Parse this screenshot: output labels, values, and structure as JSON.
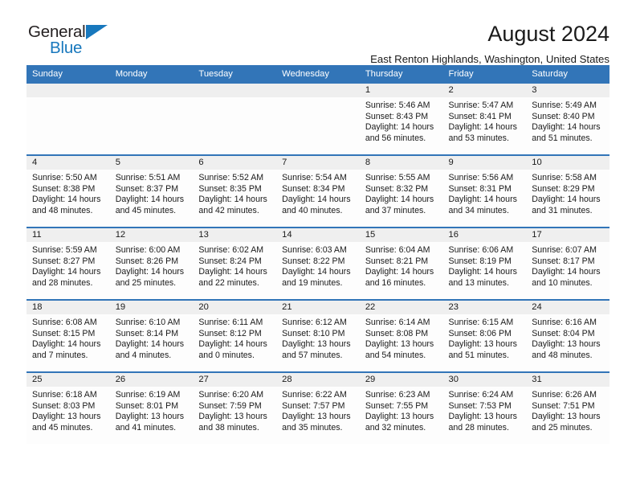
{
  "brand": {
    "name_part1": "General",
    "name_part2": "Blue",
    "triangle_icon": "triangle-icon",
    "accent_color": "#1878bd"
  },
  "header": {
    "title": "August 2024",
    "subtitle": "East Renton Highlands, Washington, United States",
    "header_bg_color": "#3275b8",
    "daynum_strip_color": "#efefef"
  },
  "weekday_headers": [
    "Sunday",
    "Monday",
    "Tuesday",
    "Wednesday",
    "Thursday",
    "Friday",
    "Saturday"
  ],
  "labels": {
    "sunrise_prefix": "Sunrise:",
    "sunset_prefix": "Sunset:",
    "daylight_prefix": "Daylight:"
  },
  "weeks": [
    [
      {
        "day": "",
        "sunrise": "",
        "sunset": "",
        "daylight": ""
      },
      {
        "day": "",
        "sunrise": "",
        "sunset": "",
        "daylight": ""
      },
      {
        "day": "",
        "sunrise": "",
        "sunset": "",
        "daylight": ""
      },
      {
        "day": "",
        "sunrise": "",
        "sunset": "",
        "daylight": ""
      },
      {
        "day": "1",
        "sunrise": "Sunrise: 5:46 AM",
        "sunset": "Sunset: 8:43 PM",
        "daylight": "Daylight: 14 hours and 56 minutes."
      },
      {
        "day": "2",
        "sunrise": "Sunrise: 5:47 AM",
        "sunset": "Sunset: 8:41 PM",
        "daylight": "Daylight: 14 hours and 53 minutes."
      },
      {
        "day": "3",
        "sunrise": "Sunrise: 5:49 AM",
        "sunset": "Sunset: 8:40 PM",
        "daylight": "Daylight: 14 hours and 51 minutes."
      }
    ],
    [
      {
        "day": "4",
        "sunrise": "Sunrise: 5:50 AM",
        "sunset": "Sunset: 8:38 PM",
        "daylight": "Daylight: 14 hours and 48 minutes."
      },
      {
        "day": "5",
        "sunrise": "Sunrise: 5:51 AM",
        "sunset": "Sunset: 8:37 PM",
        "daylight": "Daylight: 14 hours and 45 minutes."
      },
      {
        "day": "6",
        "sunrise": "Sunrise: 5:52 AM",
        "sunset": "Sunset: 8:35 PM",
        "daylight": "Daylight: 14 hours and 42 minutes."
      },
      {
        "day": "7",
        "sunrise": "Sunrise: 5:54 AM",
        "sunset": "Sunset: 8:34 PM",
        "daylight": "Daylight: 14 hours and 40 minutes."
      },
      {
        "day": "8",
        "sunrise": "Sunrise: 5:55 AM",
        "sunset": "Sunset: 8:32 PM",
        "daylight": "Daylight: 14 hours and 37 minutes."
      },
      {
        "day": "9",
        "sunrise": "Sunrise: 5:56 AM",
        "sunset": "Sunset: 8:31 PM",
        "daylight": "Daylight: 14 hours and 34 minutes."
      },
      {
        "day": "10",
        "sunrise": "Sunrise: 5:58 AM",
        "sunset": "Sunset: 8:29 PM",
        "daylight": "Daylight: 14 hours and 31 minutes."
      }
    ],
    [
      {
        "day": "11",
        "sunrise": "Sunrise: 5:59 AM",
        "sunset": "Sunset: 8:27 PM",
        "daylight": "Daylight: 14 hours and 28 minutes."
      },
      {
        "day": "12",
        "sunrise": "Sunrise: 6:00 AM",
        "sunset": "Sunset: 8:26 PM",
        "daylight": "Daylight: 14 hours and 25 minutes."
      },
      {
        "day": "13",
        "sunrise": "Sunrise: 6:02 AM",
        "sunset": "Sunset: 8:24 PM",
        "daylight": "Daylight: 14 hours and 22 minutes."
      },
      {
        "day": "14",
        "sunrise": "Sunrise: 6:03 AM",
        "sunset": "Sunset: 8:22 PM",
        "daylight": "Daylight: 14 hours and 19 minutes."
      },
      {
        "day": "15",
        "sunrise": "Sunrise: 6:04 AM",
        "sunset": "Sunset: 8:21 PM",
        "daylight": "Daylight: 14 hours and 16 minutes."
      },
      {
        "day": "16",
        "sunrise": "Sunrise: 6:06 AM",
        "sunset": "Sunset: 8:19 PM",
        "daylight": "Daylight: 14 hours and 13 minutes."
      },
      {
        "day": "17",
        "sunrise": "Sunrise: 6:07 AM",
        "sunset": "Sunset: 8:17 PM",
        "daylight": "Daylight: 14 hours and 10 minutes."
      }
    ],
    [
      {
        "day": "18",
        "sunrise": "Sunrise: 6:08 AM",
        "sunset": "Sunset: 8:15 PM",
        "daylight": "Daylight: 14 hours and 7 minutes."
      },
      {
        "day": "19",
        "sunrise": "Sunrise: 6:10 AM",
        "sunset": "Sunset: 8:14 PM",
        "daylight": "Daylight: 14 hours and 4 minutes."
      },
      {
        "day": "20",
        "sunrise": "Sunrise: 6:11 AM",
        "sunset": "Sunset: 8:12 PM",
        "daylight": "Daylight: 14 hours and 0 minutes."
      },
      {
        "day": "21",
        "sunrise": "Sunrise: 6:12 AM",
        "sunset": "Sunset: 8:10 PM",
        "daylight": "Daylight: 13 hours and 57 minutes."
      },
      {
        "day": "22",
        "sunrise": "Sunrise: 6:14 AM",
        "sunset": "Sunset: 8:08 PM",
        "daylight": "Daylight: 13 hours and 54 minutes."
      },
      {
        "day": "23",
        "sunrise": "Sunrise: 6:15 AM",
        "sunset": "Sunset: 8:06 PM",
        "daylight": "Daylight: 13 hours and 51 minutes."
      },
      {
        "day": "24",
        "sunrise": "Sunrise: 6:16 AM",
        "sunset": "Sunset: 8:04 PM",
        "daylight": "Daylight: 13 hours and 48 minutes."
      }
    ],
    [
      {
        "day": "25",
        "sunrise": "Sunrise: 6:18 AM",
        "sunset": "Sunset: 8:03 PM",
        "daylight": "Daylight: 13 hours and 45 minutes."
      },
      {
        "day": "26",
        "sunrise": "Sunrise: 6:19 AM",
        "sunset": "Sunset: 8:01 PM",
        "daylight": "Daylight: 13 hours and 41 minutes."
      },
      {
        "day": "27",
        "sunrise": "Sunrise: 6:20 AM",
        "sunset": "Sunset: 7:59 PM",
        "daylight": "Daylight: 13 hours and 38 minutes."
      },
      {
        "day": "28",
        "sunrise": "Sunrise: 6:22 AM",
        "sunset": "Sunset: 7:57 PM",
        "daylight": "Daylight: 13 hours and 35 minutes."
      },
      {
        "day": "29",
        "sunrise": "Sunrise: 6:23 AM",
        "sunset": "Sunset: 7:55 PM",
        "daylight": "Daylight: 13 hours and 32 minutes."
      },
      {
        "day": "30",
        "sunrise": "Sunrise: 6:24 AM",
        "sunset": "Sunset: 7:53 PM",
        "daylight": "Daylight: 13 hours and 28 minutes."
      },
      {
        "day": "31",
        "sunrise": "Sunrise: 6:26 AM",
        "sunset": "Sunset: 7:51 PM",
        "daylight": "Daylight: 13 hours and 25 minutes."
      }
    ]
  ]
}
